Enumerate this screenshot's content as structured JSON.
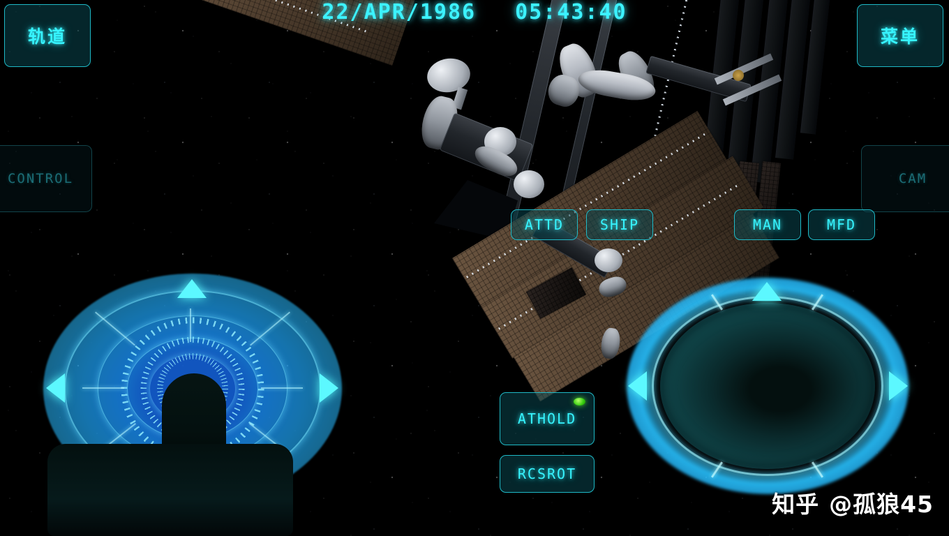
{
  "app": {
    "title": "Space Simulator HUD",
    "accent_color": "#36f4ff",
    "dim_color": "#1b6d76",
    "led_color": "#35cc0e"
  },
  "hud": {
    "clock": {
      "date": "22/APR/1986",
      "time": "05:43:40"
    },
    "corner_buttons": {
      "orbit": {
        "label": "轨道",
        "state": "active"
      },
      "menu": {
        "label": "菜单",
        "state": "active"
      },
      "control": {
        "label": "CONTROL",
        "state": "dim"
      },
      "cam": {
        "label": "CAM",
        "state": "dim"
      }
    },
    "mode_buttons": [
      {
        "label": "ATTD",
        "state": "active"
      },
      {
        "label": "SHIP",
        "state": "active"
      },
      {
        "label": "MAN",
        "state": "active"
      },
      {
        "label": "MFD",
        "state": "active"
      }
    ],
    "autopilot_buttons": [
      {
        "label": "ATHOLD",
        "state": "active",
        "led": "on"
      },
      {
        "label": "RCSROT",
        "state": "active",
        "led": "off"
      }
    ],
    "attitude_pad": {
      "name": "attitude-control-pad",
      "arrows": [
        "up",
        "left",
        "right"
      ]
    },
    "translation_pad": {
      "name": "translation-control-pad",
      "arrows": [
        "up",
        "left",
        "right"
      ]
    }
  },
  "scene": {
    "subject": "space-station",
    "background": "starfield"
  },
  "watermark": {
    "site": "知乎",
    "handle": "@孤狼45"
  }
}
